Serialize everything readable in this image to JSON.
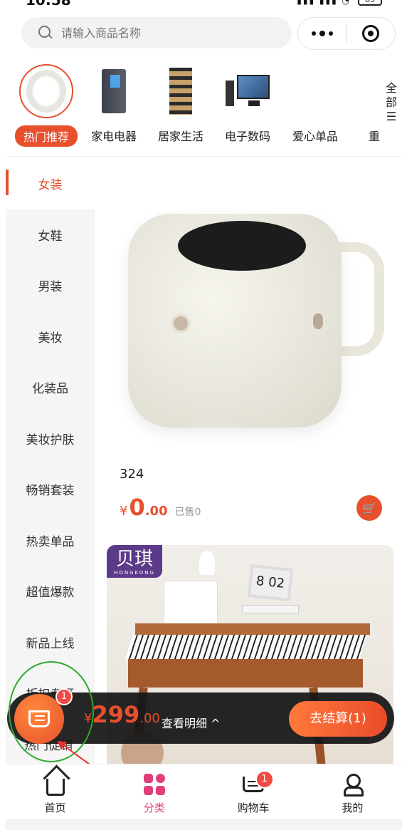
{
  "status_bar": {
    "time": "10:58",
    "battery": "85"
  },
  "search": {
    "placeholder": "请输入商品名称"
  },
  "categories": [
    {
      "label": "热门推荐",
      "icon": "ring-product-image",
      "active": true
    },
    {
      "label": "家电电器",
      "icon": "fridge-image"
    },
    {
      "label": "居家生活",
      "icon": "shelf-image"
    },
    {
      "label": "电子数码",
      "icon": "computer-image"
    },
    {
      "label": "爱心单品",
      "icon": ""
    },
    {
      "label": "重",
      "icon": ""
    }
  ],
  "all_categories_label": "全部",
  "sidebar": [
    "女装",
    "女鞋",
    "男装",
    "美妆",
    "化装品",
    "美妆护肤",
    "畅销套装",
    "热卖单品",
    "超值爆款",
    "新品上线",
    "折扣专区",
    "热门促销"
  ],
  "product1": {
    "name": "324",
    "currency": "¥",
    "price_int": "0",
    "price_dec": ".00",
    "sold": "已售0"
  },
  "product2": {
    "brand": "贝琪",
    "brand_sub": "HONGKONG",
    "frame_text": "8 02"
  },
  "checkout": {
    "badge": "1",
    "currency": "¥",
    "amount_int": "299",
    "amount_dec": ".00",
    "detail": "查看明细 ^",
    "pay_label": "去结算(1)"
  },
  "tabbar": [
    {
      "label": "首页",
      "icon": "home-icon"
    },
    {
      "label": "分类",
      "icon": "category-grid-icon",
      "active": true
    },
    {
      "label": "购物车",
      "icon": "cart-icon",
      "badge": "1"
    },
    {
      "label": "我的",
      "icon": "user-icon"
    }
  ],
  "colors": {
    "accent": "#e8502d",
    "tab_active": "#e0407a",
    "badge": "#f04a43"
  }
}
